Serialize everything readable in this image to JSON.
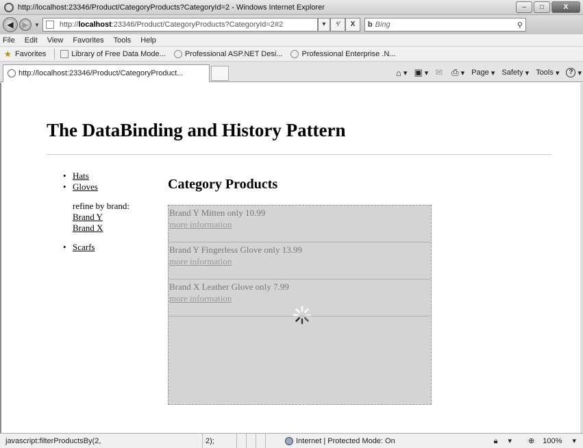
{
  "window": {
    "title": "http://localhost:23346/Product/CategoryProducts?CategoryId=2 - Windows Internet Explorer",
    "min_label": "–",
    "max_label": "□",
    "close_label": "X"
  },
  "nav": {
    "back_glyph": "◀",
    "forward_glyph": "▶",
    "dropdown_glyph": "▼",
    "url_prefix": "http://",
    "url_host": "localhost",
    "url_rest": ":23346/Product/CategoryProducts?CategoryId=2#2",
    "url_drop": "▾",
    "refresh_glyph": "⁴⁄",
    "stop_glyph": "X",
    "search_placeholder": "Bing",
    "search_engine_icon": "b",
    "search_glyph": "⚲"
  },
  "menu": {
    "items": [
      "File",
      "Edit",
      "View",
      "Favorites",
      "Tools",
      "Help"
    ]
  },
  "favorites": {
    "label": "Favorites",
    "items": [
      "Library of Free Data Mode...",
      "Professional ASP.NET Desi...",
      "Professional Enterprise .N..."
    ]
  },
  "tab": {
    "label": "http://localhost:23346/Product/CategoryProduct..."
  },
  "commands": {
    "home_glyph": "⌂",
    "feeds_glyph": "▣",
    "mail_glyph": "✉",
    "print_glyph": "⎙",
    "page_label": "Page",
    "safety_label": "Safety",
    "tools_label": "Tools",
    "help_glyph": "?",
    "drop": "▾"
  },
  "page": {
    "title": "The DataBinding and History Pattern",
    "categories": [
      {
        "label": "Hats"
      },
      {
        "label": "Gloves"
      }
    ],
    "refine_label": "refine by brand:",
    "brands": [
      "Brand Y",
      "Brand X"
    ],
    "other_category": "Scarfs",
    "main_title": "Category Products",
    "products": [
      {
        "text": "Brand Y Mitten only 10.99",
        "link": "more information"
      },
      {
        "text": "Brand Y Fingerless Glove only 13.99",
        "link": "more information"
      },
      {
        "text": "Brand X Leather Glove only 7.99",
        "link": "more information"
      }
    ]
  },
  "status": {
    "text": "javascript:filterProductsBy(2,",
    "text_tail": "2);",
    "zone": "Internet | Protected Mode: On",
    "zoom": "100%",
    "zoom_icon": "⊕",
    "security_icon": "🔒︎",
    "drop": "▾"
  }
}
